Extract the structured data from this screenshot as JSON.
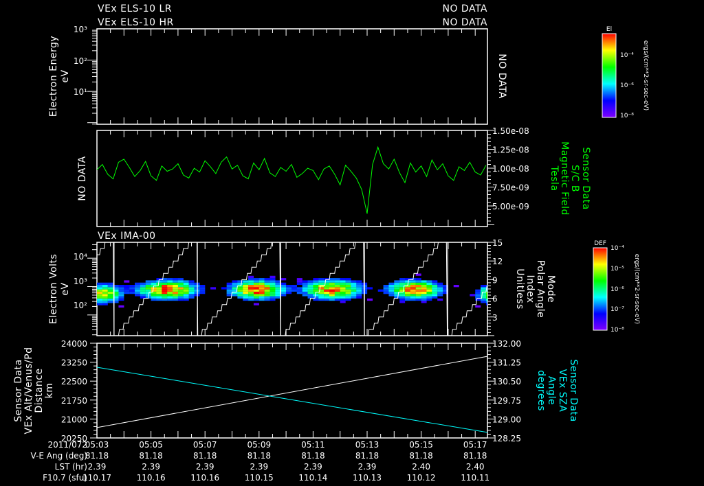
{
  "header": {
    "els_lr": "VEx ELS-10 LR",
    "els_hr": "VEx ELS-10 HR",
    "lr_status": "NO DATA",
    "hr_status": "NO DATA",
    "ima_title": "VEx IMA-00"
  },
  "colorbars": {
    "ei": {
      "title": "El",
      "ticks": [
        "10⁻⁴",
        "10⁻⁶",
        "10⁻⁸"
      ],
      "units": "ergs/(cm**2-sr-sec-eV)"
    },
    "def": {
      "title": "DEF",
      "ticks": [
        "10⁻⁴",
        "10⁻⁵",
        "10⁻⁶",
        "10⁻⁷",
        "10⁻⁸"
      ],
      "units": "ergs/(cm**2-sr-sec-eV)"
    },
    "colormap": [
      "#ff0000",
      "#ffff00",
      "#00ff00",
      "#00ffff",
      "#0000ff",
      "#8000ff"
    ]
  },
  "time_axis": {
    "date": "2011/072",
    "ticks": [
      "05:03",
      "05:05",
      "05:07",
      "05:09",
      "05:11",
      "05:13",
      "05:15",
      "05:17"
    ],
    "rows": [
      {
        "label": "V-E Ang (deg)",
        "values": [
          "81.18",
          "81.18",
          "81.18",
          "81.18",
          "81.18",
          "81.18",
          "81.18",
          "81.18"
        ]
      },
      {
        "label": "LST (hr)",
        "values": [
          "2.39",
          "2.39",
          "2.39",
          "2.39",
          "2.39",
          "2.39",
          "2.40",
          "2.40"
        ]
      },
      {
        "label": "F10.7 (sfu)",
        "values": [
          "110.17",
          "110.16",
          "110.16",
          "110.15",
          "110.14",
          "110.13",
          "110.12",
          "110.11"
        ]
      }
    ]
  },
  "chart_data": [
    {
      "type": "heatmap",
      "ylabel": [
        "Electron Energy",
        "eV"
      ],
      "yscale": "log",
      "ytick_labels": [
        "10³",
        "10²",
        "10¹"
      ],
      "ylim": [
        1,
        1000
      ],
      "no_data_label": "NO DATA"
    },
    {
      "type": "line",
      "no_data_label": "NO DATA",
      "ylabel_right": [
        "Sensor Data",
        "S/C B",
        "Magnetic Field",
        "Tesla"
      ],
      "ytick_labels": [
        "1.50e-08",
        "1.25e-08",
        "1.00e-08",
        "7.50e-09",
        "5.00e-09"
      ],
      "ylim": [
        2.3e-09,
        1.5e-08
      ],
      "color": "#00ff00",
      "x_start": "05:03:00",
      "x_step_s": 12,
      "values": [
        9.8e-09,
        1.05e-08,
        9.2e-09,
        8.6e-09,
        1.08e-08,
        1.12e-08,
        1.01e-08,
        8.9e-09,
        9.7e-09,
        1.09e-08,
        9e-09,
        8.4e-09,
        1.03e-08,
        9.6e-09,
        9.9e-09,
        1.06e-08,
        9.1e-09,
        8.7e-09,
        1e-08,
        9.5e-09,
        1.1e-08,
        1.02e-08,
        9.3e-09,
        1.08e-08,
        1.15e-08,
        9.9e-09,
        1.04e-08,
        9e-09,
        8.6e-09,
        1.07e-08,
        9.8e-09,
        1.13e-08,
        9.4e-09,
        8.9e-09,
        1.01e-08,
        9.6e-09,
        1.05e-08,
        8.8e-09,
        9.3e-09,
        1e-08,
        9.7e-09,
        8.5e-09,
        9.9e-09,
        1.03e-08,
        9.2e-09,
        7.8e-09,
        1.04e-08,
        9.6e-09,
        8.7e-09,
        7.2e-09,
        4e-09,
        1.05e-08,
        1.28e-08,
        1.06e-08,
        9.9e-09,
        1.12e-08,
        9.4e-09,
        8.1e-09,
        1.07e-08,
        9.5e-09,
        1.03e-08,
        8.9e-09,
        1.11e-08,
        9.8e-09,
        1.06e-08,
        9e-09,
        8.4e-09,
        1.02e-08,
        9.7e-09,
        1.08e-08,
        9.5e-09,
        9.1e-09,
        1.04e-08
      ]
    },
    {
      "type": "heatmap",
      "title": "VEx IMA-00",
      "ylabel": [
        "Electron Volts",
        "eV"
      ],
      "yscale": "log",
      "ytick_labels": [
        "10⁴",
        "10³",
        "10²"
      ],
      "ylim": [
        18,
        36000
      ],
      "ylabel_right": [
        "Mode",
        "Polar Angle",
        "Index",
        "Unitless"
      ],
      "ytick_labels_right": [
        "15",
        "12",
        "9",
        "6",
        "3"
      ],
      "ylim_right": [
        0,
        15
      ],
      "blobs": [
        {
          "t": "05:03:10",
          "log_e": 2.7,
          "sigma_s": 35,
          "peak": 0.75
        },
        {
          "t": "05:05:31",
          "log_e": 2.85,
          "sigma_s": 55,
          "peak": 1.0
        },
        {
          "t": "05:08:50",
          "log_e": 2.85,
          "sigma_s": 50,
          "peak": 1.0
        },
        {
          "t": "05:11:38",
          "log_e": 2.85,
          "sigma_s": 55,
          "peak": 0.95
        },
        {
          "t": "05:14:41",
          "log_e": 2.85,
          "sigma_s": 50,
          "peak": 0.95
        },
        {
          "t": "05:17:25",
          "log_e": 2.7,
          "sigma_s": 25,
          "peak": 0.55
        }
      ],
      "mode_resets": [
        "05:03:38",
        "05:06:43",
        "05:09:48",
        "05:12:54",
        "05:15:59"
      ]
    },
    {
      "type": "line",
      "ylabel": [
        "Sensor Data",
        "VEx Alt/Venus/Pd",
        "Distance",
        "km"
      ],
      "ytick_labels": [
        "24000",
        "23250",
        "22500",
        "21750",
        "21000",
        "20250"
      ],
      "ylim": [
        20250,
        24000
      ],
      "ylabel_right": [
        "Sensor Data",
        "VEx SZA",
        "Angle",
        "degrees"
      ],
      "ytick_labels_right": [
        "132.00",
        "131.25",
        "130.50",
        "129.75",
        "129.00",
        "128.25"
      ],
      "ylim_right": [
        128.25,
        132.0
      ],
      "series": [
        {
          "axis": "left",
          "color": "#ffffff",
          "x": [
            "05:03:00",
            "05:17:32"
          ],
          "values": [
            20660,
            23480
          ]
        },
        {
          "axis": "right",
          "color": "#00ffff",
          "x": [
            "05:03:00",
            "05:17:32"
          ],
          "values": [
            131.05,
            128.47
          ]
        }
      ]
    }
  ]
}
